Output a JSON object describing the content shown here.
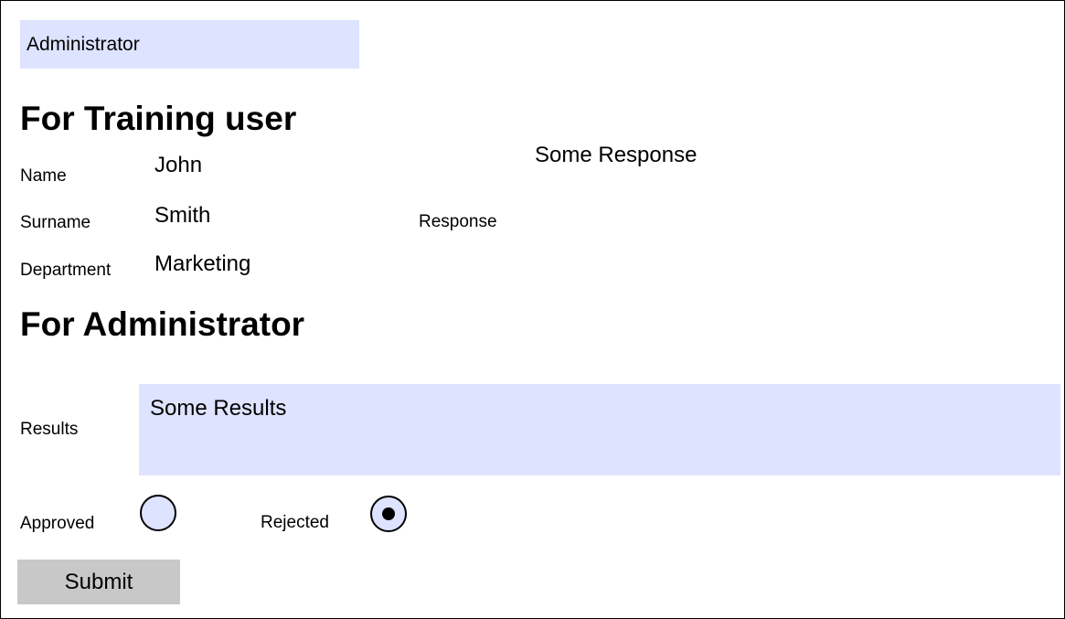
{
  "role_select": {
    "selected": "Administrator"
  },
  "training_section": {
    "heading": "For Training user",
    "name_label": "Name",
    "name_value": "John",
    "surname_label": "Surname",
    "surname_value": "Smith",
    "department_label": "Department",
    "department_value": "Marketing",
    "response_label": "Response",
    "response_value": "Some Response"
  },
  "admin_section": {
    "heading": "For Administrator",
    "results_label": "Results",
    "results_value": "Some Results",
    "approved_label": "Approved",
    "approved_checked": false,
    "rejected_label": "Rejected",
    "rejected_checked": true,
    "submit_label": "Submit"
  },
  "colors": {
    "field_background": "#dee3ff",
    "button_background": "#c8c8c8",
    "border": "#000000"
  }
}
